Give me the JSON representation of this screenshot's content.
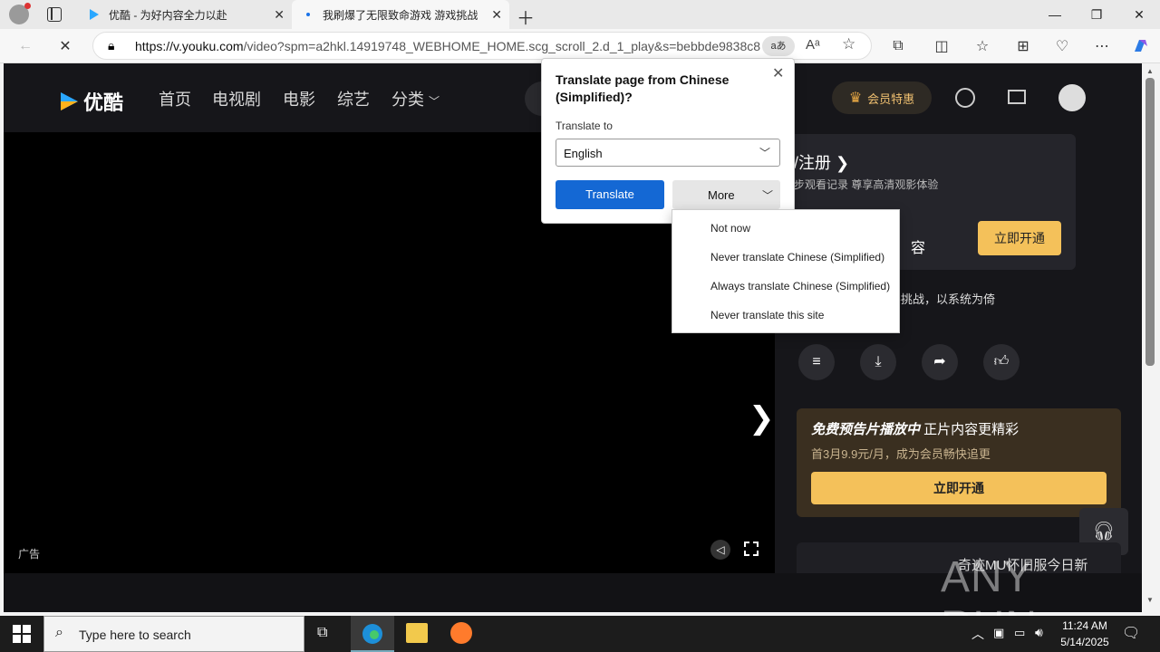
{
  "browser": {
    "tabs": [
      {
        "title": "优酷 - 为好内容全力以赴"
      },
      {
        "title": "我刷爆了无限致命游戏 游戏挑战"
      }
    ],
    "url_host": "https://v.youku.com",
    "url_rest": "/video?spm=a2hkl.14919748_WEBHOME_HOME.scg_scroll_2.d_1_play&s=bebbde9838c8...",
    "read_aloud_badge": "aあ"
  },
  "youku": {
    "logo_text": "优酷",
    "nav": [
      "首页",
      "电视剧",
      "电影",
      "综艺",
      "分类"
    ],
    "vip_button": "会员特惠",
    "login_text": "/注册",
    "login_sub": "步观看记录 尊享高清观影体验",
    "vip_card_text": "容",
    "vip_open_button": "立即开通",
    "desc_text": "或至生死游戏，智斗挑战，以系统为倚",
    "promo_title_bold": "免费预告片播放中",
    "promo_title_rest": " 正片内容更精彩",
    "promo_sub": "首3月9.9元/月，成为会员畅快追更",
    "promo_button": "立即开通",
    "ad_label": "广告",
    "bottom_ad_text": "奇迹MU怀旧服今日新"
  },
  "translate": {
    "title": "Translate page from Chinese (Simplified)?",
    "to_label": "Translate to",
    "language": "English",
    "translate_button": "Translate",
    "more_button": "More",
    "menu": [
      "Not now",
      "Never translate Chinese (Simplified)",
      "Always translate Chinese (Simplified)",
      "Never translate this site"
    ]
  },
  "taskbar": {
    "search_placeholder": "Type here to search",
    "time": "11:24 AM",
    "date": "5/14/2025"
  },
  "watermark": "ANY RUN"
}
